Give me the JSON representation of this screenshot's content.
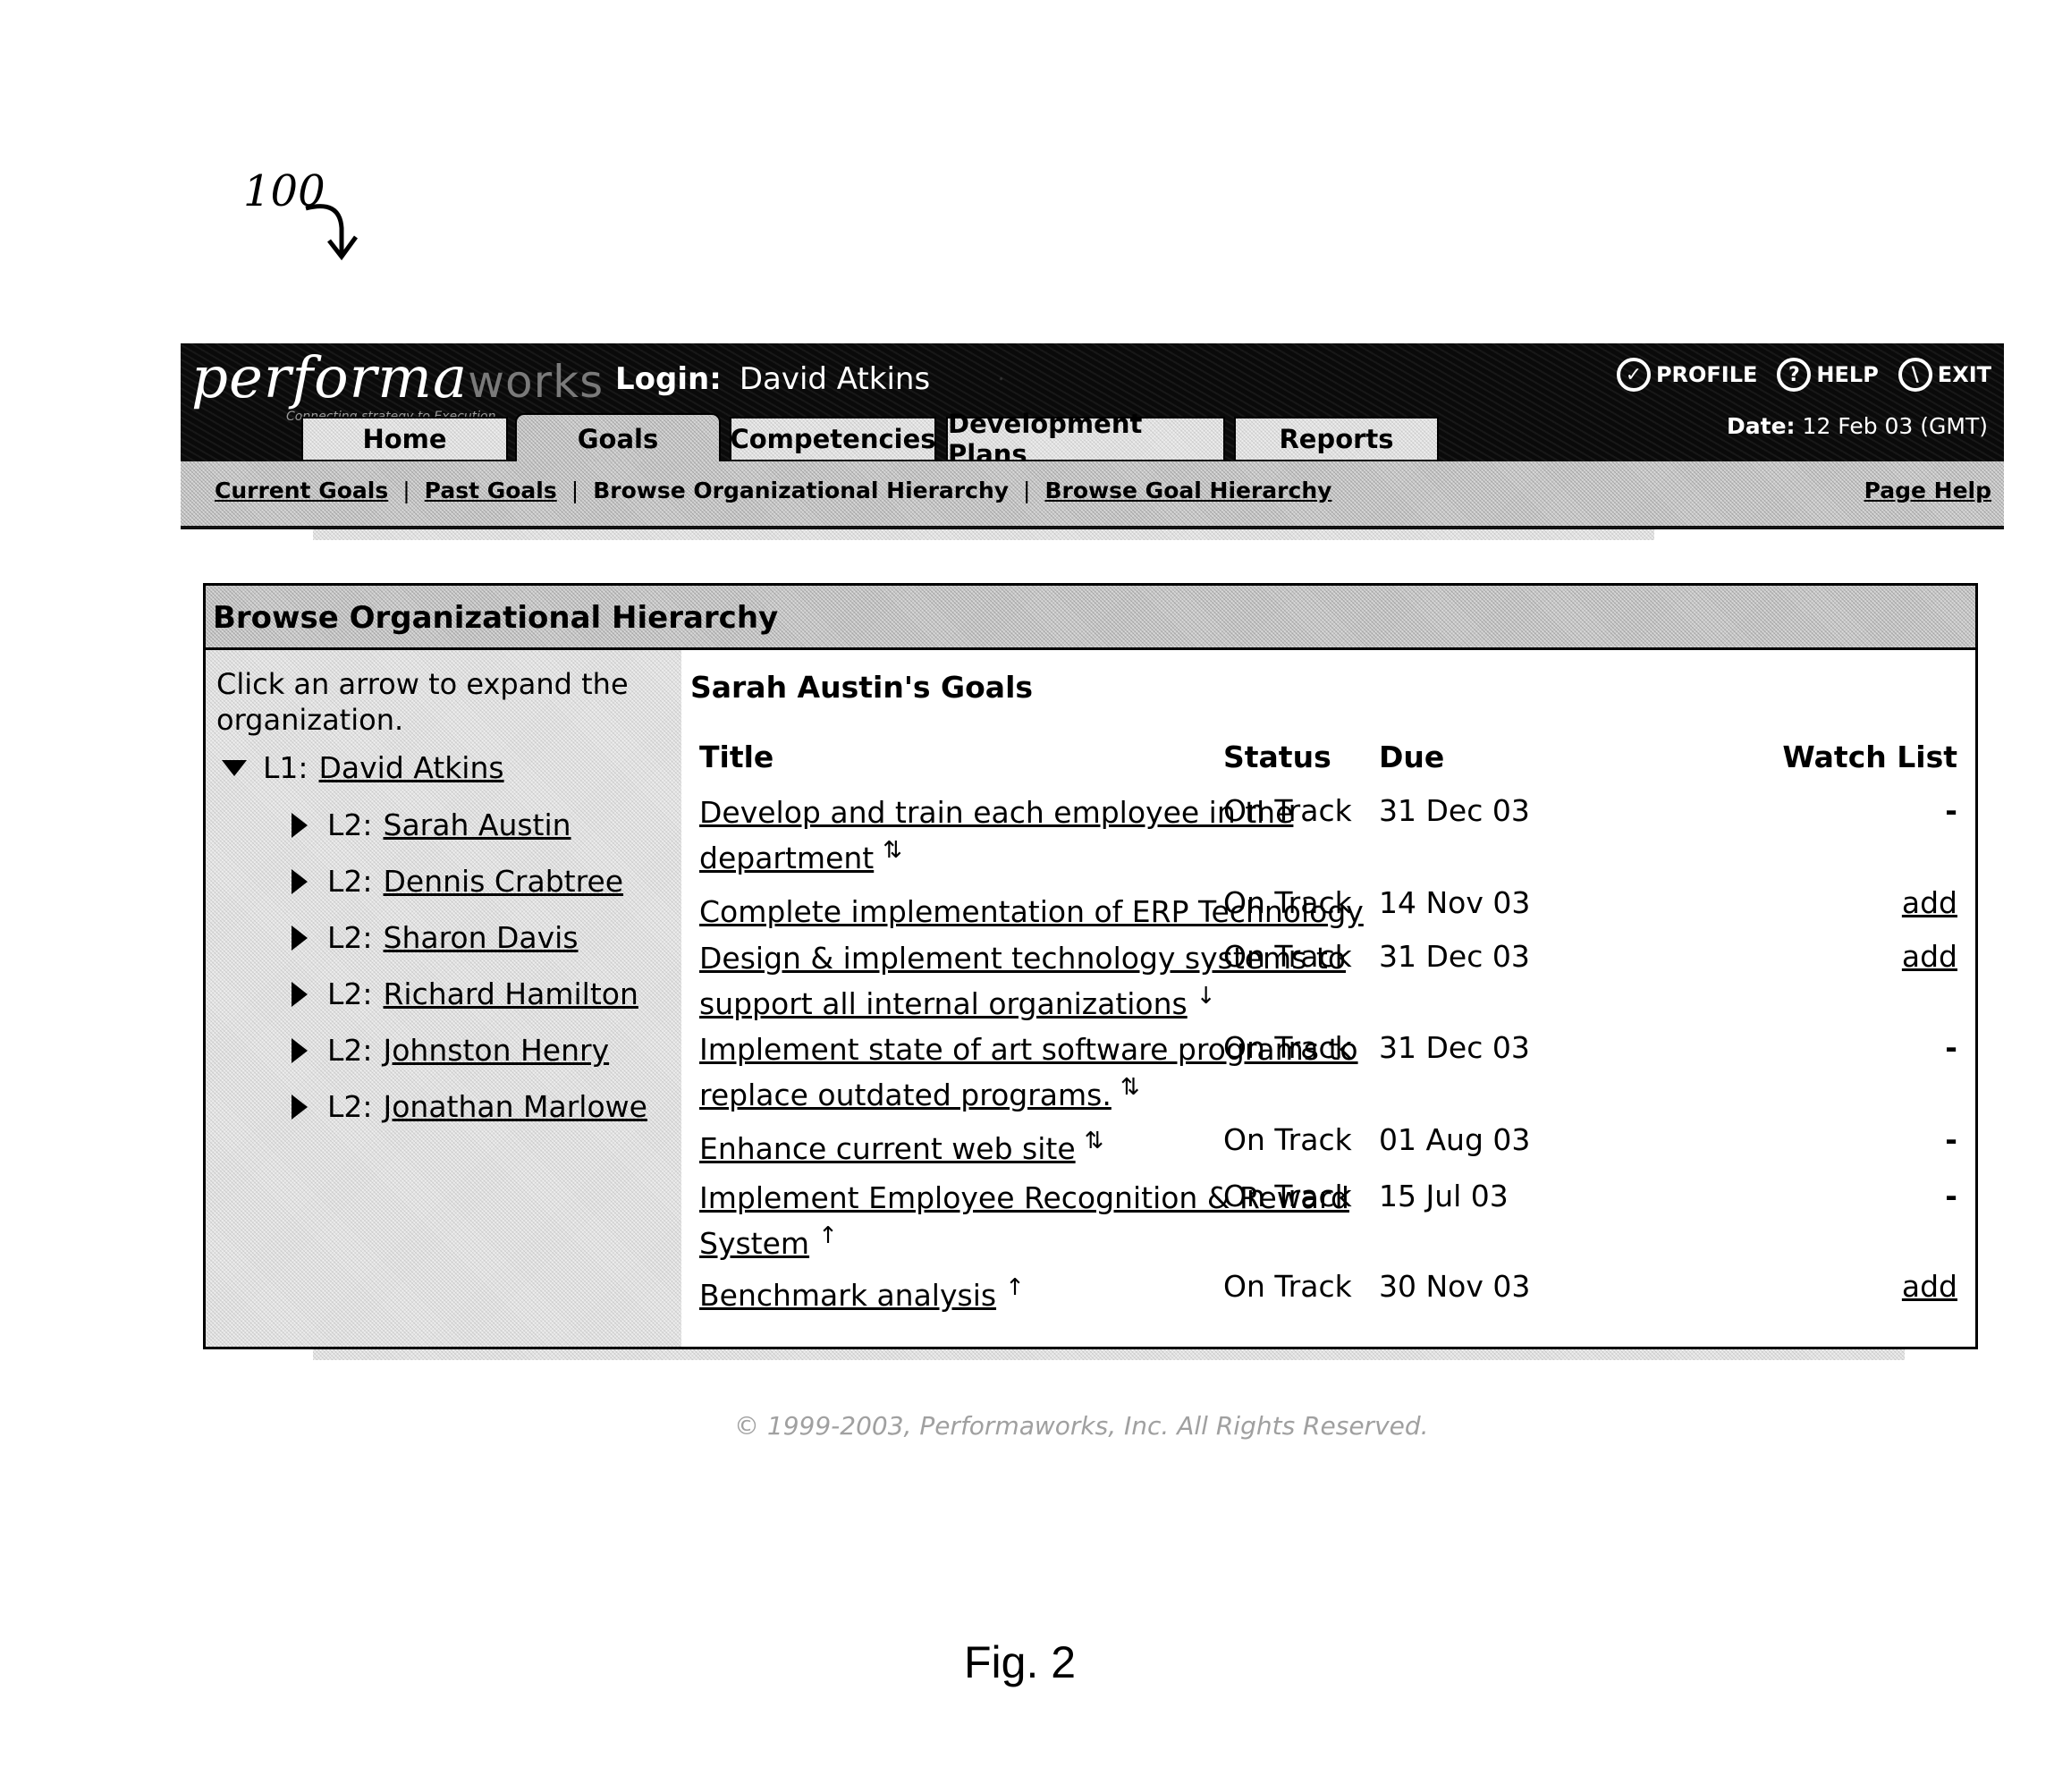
{
  "annotation": {
    "ref_number": "100",
    "figure_label": "Fig. 2"
  },
  "header": {
    "logo_main": "performa",
    "logo_accent": "works",
    "tagline": "Connecting strategy to Execution",
    "login_label": "Login:",
    "login_user": "David Atkins",
    "utility_links": [
      {
        "label": "PROFILE",
        "icon": "check-icon"
      },
      {
        "label": "HELP",
        "icon": "question-icon"
      },
      {
        "label": "EXIT",
        "icon": "exit-icon"
      }
    ],
    "date_label": "Date:",
    "date_value": "12 Feb 03 (GMT)",
    "tabs": [
      {
        "label": "Home",
        "active": false
      },
      {
        "label": "Goals",
        "active": true
      },
      {
        "label": "Competencies",
        "active": false
      },
      {
        "label": "Development Plans",
        "active": false
      },
      {
        "label": "Reports",
        "active": false
      }
    ],
    "subnav": [
      {
        "label": "Current Goals",
        "current": false
      },
      {
        "label": "Past Goals",
        "current": false
      },
      {
        "label": "Browse Organizational Hierarchy",
        "current": true
      },
      {
        "label": "Browse Goal Hierarchy",
        "current": false
      }
    ],
    "separator": "|",
    "page_help": "Page Help"
  },
  "panel": {
    "title": "Browse Organizational Hierarchy",
    "instructions": "Click an arrow to expand the organization.",
    "tree": [
      {
        "level": "L1:",
        "name": "David Atkins",
        "expanded": true
      },
      {
        "level": "L2:",
        "name": "Sarah Austin",
        "expanded": false
      },
      {
        "level": "L2:",
        "name": "Dennis Crabtree",
        "expanded": false
      },
      {
        "level": "L2:",
        "name": "Sharon Davis",
        "expanded": false
      },
      {
        "level": "L2:",
        "name": "Richard Hamilton",
        "expanded": false
      },
      {
        "level": "L2:",
        "name": "Johnston Henry",
        "expanded": false
      },
      {
        "level": "L2:",
        "name": "Jonathan Marlowe",
        "expanded": false
      }
    ]
  },
  "goals": {
    "heading": "Sarah Austin's Goals",
    "columns": {
      "title": "Title",
      "status": "Status",
      "due": "Due",
      "watch": "Watch List"
    },
    "rows": [
      {
        "title": "Develop and train each employee in the department",
        "sort": "⇅",
        "status": "On Track",
        "due": "31 Dec 03",
        "watch": "-"
      },
      {
        "title": "Complete implementation of ERP Technology",
        "sort": "",
        "status": "On Track",
        "due": "14 Nov 03",
        "watch": "add"
      },
      {
        "title": "Design & implement technology systems to support all internal organizations",
        "sort": "↓",
        "status": "On Track",
        "due": "31 Dec 03",
        "watch": "add"
      },
      {
        "title": "Implement state of art software programs to replace outdated programs.",
        "sort": "⇅",
        "status": "On Track",
        "due": "31 Dec 03",
        "watch": "-"
      },
      {
        "title": "Enhance current web site",
        "sort": "⇅",
        "status": "On Track",
        "due": "01 Aug 03",
        "watch": "-"
      },
      {
        "title": "Implement Employee Recognition & Reward System",
        "sort": "↑",
        "status": "On Track",
        "due": "15 Jul 03",
        "watch": "-"
      },
      {
        "title": "Benchmark analysis",
        "sort": "↑",
        "status": "On Track",
        "due": "30 Nov 03",
        "watch": "add"
      }
    ]
  },
  "footer": {
    "copyright": "© 1999-2003, Performaworks, Inc. All Rights Reserved."
  }
}
